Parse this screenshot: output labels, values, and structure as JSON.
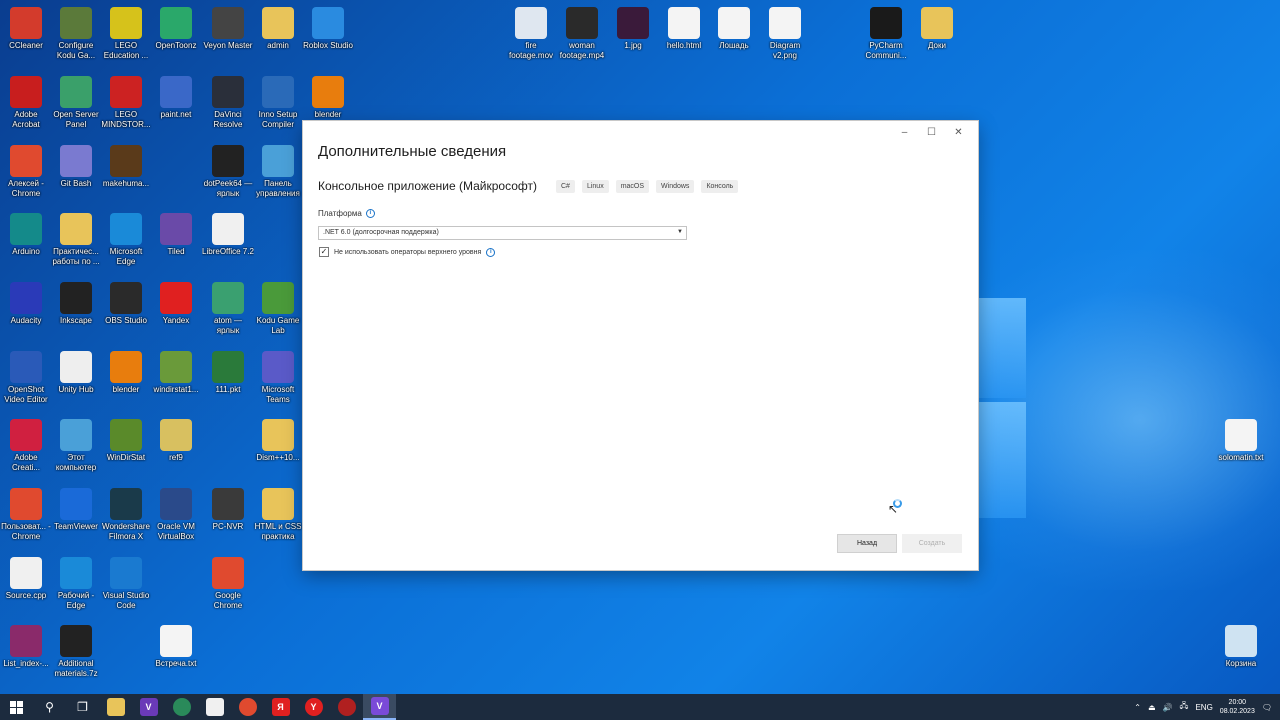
{
  "desktop": {
    "icons": [
      {
        "label": "CCleaner",
        "icon": "ccleaner-icon",
        "color": "#d33b2c"
      },
      {
        "label": "Configure Kodu Ga...",
        "icon": "kodu-config-icon",
        "color": "#5b7a3a"
      },
      {
        "label": "LEGO Education ...",
        "icon": "lego-education-icon",
        "color": "#d6c21b"
      },
      {
        "label": "OpenToonz",
        "icon": "opentoonz-icon",
        "color": "#2aa86a"
      },
      {
        "label": "Veyon Master",
        "icon": "veyon-icon",
        "color": "#444444"
      },
      {
        "label": "admin",
        "icon": "folder-user-icon",
        "color": "#e8c45a"
      },
      {
        "label": "Roblox Studio",
        "icon": "roblox-studio-icon",
        "color": "#2a8be0"
      },
      {
        "label": "Adobe Acrobat",
        "icon": "adobe-acrobat-icon",
        "color": "#c81e1e"
      },
      {
        "label": "Open Server Panel",
        "icon": "open-server-icon",
        "color": "#3aa06a"
      },
      {
        "label": "LEGO MINDSTOR...",
        "icon": "lego-mindstorms-icon",
        "color": "#cc2222"
      },
      {
        "label": "paint.net",
        "icon": "paintnet-icon",
        "color": "#3a68c8"
      },
      {
        "label": "DaVinci Resolve",
        "icon": "davinci-resolve-icon",
        "color": "#2a2f3a"
      },
      {
        "label": "Inno Setup Compiler",
        "icon": "inno-setup-icon",
        "color": "#2a6ab8"
      },
      {
        "label": "blender",
        "icon": "blender-icon",
        "color": "#e87d0d"
      },
      {
        "label": "Алексей - Chrome",
        "icon": "chrome-icon",
        "color": "#e04a2f"
      },
      {
        "label": "Git Bash",
        "icon": "git-bash-icon",
        "color": "#7a7ad0"
      },
      {
        "label": "makehuma...",
        "icon": "makehuman-icon",
        "color": "#5a3a1a"
      },
      {
        "label": "dotPeek64 — ярлык",
        "icon": "dotpeek-icon",
        "color": "#222222"
      },
      {
        "label": "Панель управления",
        "icon": "control-panel-icon",
        "color": "#4aa0d8"
      },
      {
        "label": "Arduino",
        "icon": "arduino-icon",
        "color": "#148a8a"
      },
      {
        "label": "Практичес... работы по ...",
        "icon": "folder-icon",
        "color": "#e8c45a"
      },
      {
        "label": "Microsoft Edge",
        "icon": "edge-icon",
        "color": "#1a8ad8"
      },
      {
        "label": "Tiled",
        "icon": "tiled-icon",
        "color": "#6a4aa8"
      },
      {
        "label": "LibreOffice 7.2",
        "icon": "libreoffice-icon",
        "color": "#f0f0f0"
      },
      {
        "label": "Audacity",
        "icon": "audacity-icon",
        "color": "#2a3ab8"
      },
      {
        "label": "Inkscape",
        "icon": "inkscape-icon",
        "color": "#222222"
      },
      {
        "label": "OBS Studio",
        "icon": "obs-icon",
        "color": "#2a2a2a"
      },
      {
        "label": "Yandex",
        "icon": "yandex-icon",
        "color": "#e02020"
      },
      {
        "label": "atom — ярлык",
        "icon": "atom-icon",
        "color": "#3aa070"
      },
      {
        "label": "Kodu Game Lab",
        "icon": "kodu-icon",
        "color": "#4a9a3a"
      },
      {
        "label": "OpenShot Video Editor",
        "icon": "openshot-icon",
        "color": "#2a5ab8"
      },
      {
        "label": "Unity Hub",
        "icon": "unity-icon",
        "color": "#eeeeee"
      },
      {
        "label": "blender",
        "icon": "blender-icon",
        "color": "#e87d0d"
      },
      {
        "label": "windirstat1...",
        "icon": "windirstat-file-icon",
        "color": "#6a9a3a"
      },
      {
        "label": "111.pkt",
        "icon": "packet-tracer-icon",
        "color": "#2a7a3a"
      },
      {
        "label": "Microsoft Teams",
        "icon": "teams-icon",
        "color": "#5a5ac8"
      },
      {
        "label": "Adobe Creati...",
        "icon": "adobe-cc-icon",
        "color": "#d02040"
      },
      {
        "label": "Этот компьютер",
        "icon": "this-pc-icon",
        "color": "#4aa0d8"
      },
      {
        "label": "WinDirStat",
        "icon": "windirstat-icon",
        "color": "#5a8a2a"
      },
      {
        "label": "ref9",
        "icon": "ref9-icon",
        "color": "#d8c060"
      },
      {
        "label": "Dism++10...",
        "icon": "folder-icon",
        "color": "#e8c45a"
      },
      {
        "label": "Пользоват... - Chrome",
        "icon": "chrome-icon",
        "color": "#e04a2f"
      },
      {
        "label": "TeamViewer",
        "icon": "teamviewer-icon",
        "color": "#1a6ad8"
      },
      {
        "label": "Wondershare Filmora X",
        "icon": "filmora-icon",
        "color": "#1a3a4a"
      },
      {
        "label": "Oracle VM VirtualBox",
        "icon": "virtualbox-icon",
        "color": "#2a4a8a"
      },
      {
        "label": "PC-NVR",
        "icon": "pc-nvr-icon",
        "color": "#3a3a3a"
      },
      {
        "label": "HTML и CSS практика",
        "icon": "folder-icon",
        "color": "#e8c45a"
      },
      {
        "label": "Source.cpp",
        "icon": "cpp-file-icon",
        "color": "#f0f0f0"
      },
      {
        "label": "Рабочий - Edge",
        "icon": "edge-icon",
        "color": "#1a8ad8"
      },
      {
        "label": "Visual Studio Code",
        "icon": "vscode-icon",
        "color": "#1a7ad0"
      },
      {
        "label": "Google Chrome",
        "icon": "chrome-icon",
        "color": "#e04a2f"
      },
      {
        "label": "List_index-...",
        "icon": "winrar-icon",
        "color": "#8a2a6a"
      },
      {
        "label": "Additional materials.7z",
        "icon": "7zip-icon",
        "color": "#222222"
      },
      {
        "label": "Встреча.txt",
        "icon": "text-file-icon",
        "color": "#f4f4f4"
      },
      {
        "label": "fire footage.mov",
        "icon": "video-file-icon",
        "color": "#dfe7f0"
      },
      {
        "label": "woman footage.mp4",
        "icon": "video-thumb-icon",
        "color": "#2a2a2a"
      },
      {
        "label": "1.jpg",
        "icon": "image-thumb-icon",
        "color": "#3a1a3a"
      },
      {
        "label": "hello.html",
        "icon": "html-file-icon",
        "color": "#f4f4f4"
      },
      {
        "label": "Лошадь",
        "icon": "blank-file-icon",
        "color": "#f4f4f4"
      },
      {
        "label": "Diagram v2.png",
        "icon": "png-file-icon",
        "color": "#f4f4f4"
      },
      {
        "label": "PyCharm Communi...",
        "icon": "pycharm-icon",
        "color": "#1a1a1a"
      },
      {
        "label": "Доки",
        "icon": "folder-icon",
        "color": "#e8c45a"
      },
      {
        "label": "solomatin.txt",
        "icon": "text-file-icon",
        "color": "#f4f4f4"
      },
      {
        "label": "Корзина",
        "icon": "recycle-bin-icon",
        "color": "#cfe3f2"
      }
    ]
  },
  "dialog": {
    "title": "Дополнительные сведения",
    "project_name": "Консольное приложение (Майкрософт)",
    "tags": [
      "C#",
      "Linux",
      "macOS",
      "Windows",
      "Консоль"
    ],
    "platform_label": "Платформа",
    "platform_value": ".NET 6.0 (долгосрочная поддержка)",
    "checkbox_label": "Не использовать операторы верхнего уровня",
    "checkbox_checked": "✓",
    "back_label": "Назад",
    "create_label": "Создать",
    "window_controls": {
      "minimize": "–",
      "maximize": "☐",
      "close": "✕"
    }
  },
  "taskbar": {
    "language": "ENG",
    "time": "20:00",
    "date": "08.02.2023"
  }
}
